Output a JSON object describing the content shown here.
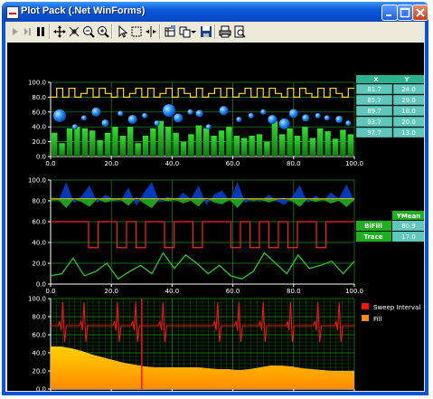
{
  "window": {
    "title": "Plot Pack (.Net WinForms)"
  },
  "toolbar": {
    "icons": [
      "play-icon",
      "step-icon",
      "pause-icon",
      "pan-icon",
      "axes-pan-icon",
      "zoom-out-icon",
      "zoom-in-icon",
      "select-pointer-icon",
      "zoom-box-icon",
      "cursor-icon",
      "data-view-icon",
      "copy-icon",
      "dropdown-icon",
      "save-icon",
      "print-icon",
      "print-preview-icon"
    ]
  },
  "axes": {
    "x_ticks": [
      "0.0",
      "20.0",
      "40.0",
      "60.0",
      "80.0",
      "100.0"
    ],
    "y_ticks": [
      "100.0",
      "80.0",
      "60.0",
      "40.0",
      "20.0",
      "0.0"
    ]
  },
  "table1": {
    "headers": [
      "X",
      "Y"
    ],
    "rows": [
      [
        "81.7",
        "24.0"
      ],
      [
        "85.7",
        "29.0"
      ],
      [
        "89.7",
        "18.0"
      ],
      [
        "93.7",
        "20.0"
      ],
      [
        "97.7",
        "13.0"
      ]
    ]
  },
  "table2": {
    "header": "YMean",
    "rows": [
      [
        "BiFill",
        "80.9"
      ],
      [
        "Trace",
        "17.0"
      ]
    ]
  },
  "legend3": {
    "items": [
      {
        "label": "Sweep Interval",
        "color": "#ff1010"
      },
      {
        "label": "Fill",
        "color": "#ff8c00"
      }
    ]
  },
  "chart_data": [
    {
      "type": "line",
      "panel": "top",
      "ylim": [
        0,
        100
      ],
      "xlim": [
        0,
        100
      ],
      "series": [
        {
          "kind": "step",
          "color": "#ffe000",
          "values": [
            80,
            92,
            80,
            92,
            80,
            85,
            92,
            80,
            92,
            85,
            80,
            92,
            80,
            85,
            92,
            80,
            92,
            80,
            85,
            92,
            80,
            92,
            85,
            80,
            92,
            80,
            85,
            92,
            80,
            92,
            80,
            85,
            92,
            80,
            92,
            80,
            92,
            85,
            80,
            92,
            80,
            92,
            85,
            80,
            92,
            80,
            92,
            85,
            80,
            92
          ]
        },
        {
          "kind": "bubble",
          "color": "#1e90ff",
          "points": [
            [
              3,
              55,
              7
            ],
            [
              8,
              40,
              3
            ],
            [
              11,
              52,
              3
            ],
            [
              15,
              60,
              5
            ],
            [
              18,
              45,
              4
            ],
            [
              23,
              58,
              3
            ],
            [
              27,
              50,
              5
            ],
            [
              31,
              55,
              3
            ],
            [
              35,
              45,
              3
            ],
            [
              39,
              62,
              7
            ],
            [
              42,
              52,
              5
            ],
            [
              46,
              60,
              3
            ],
            [
              49,
              58,
              4
            ],
            [
              52,
              40,
              3
            ],
            [
              57,
              62,
              5
            ],
            [
              62,
              50,
              3
            ],
            [
              66,
              55,
              3
            ],
            [
              70,
              60,
              3
            ],
            [
              73,
              50,
              5
            ],
            [
              77,
              44,
              6
            ],
            [
              80,
              58,
              5
            ],
            [
              84,
              52,
              4
            ],
            [
              88,
              55,
              3
            ],
            [
              91,
              52,
              3
            ],
            [
              95,
              50,
              4
            ],
            [
              98,
              45,
              3
            ]
          ]
        },
        {
          "kind": "bar",
          "color": "#22cc22",
          "values": [
            32,
            18,
            38,
            40,
            38,
            35,
            22,
            32,
            40,
            28,
            40,
            18,
            28,
            38,
            48,
            40,
            32,
            20,
            30,
            42,
            38,
            28,
            35,
            40,
            28,
            25,
            28,
            30,
            20,
            48,
            30,
            38,
            28,
            40,
            25,
            38,
            34,
            24,
            36,
            30
          ]
        }
      ]
    },
    {
      "type": "area",
      "panel": "middle",
      "ylim": [
        0,
        100
      ],
      "xlim": [
        0,
        100
      ],
      "series": [
        {
          "kind": "bifill",
          "color": "#0040d0",
          "values": [
            82,
            80,
            98,
            78,
            85,
            95,
            78,
            86,
            82,
            80,
            93,
            75,
            88,
            98,
            78,
            84,
            80,
            88,
            82,
            95,
            76,
            86,
            90,
            80,
            98,
            78,
            82,
            80,
            86,
            80,
            76,
            84,
            95,
            78,
            85,
            80,
            88,
            82,
            96,
            80
          ]
        },
        {
          "kind": "step",
          "color": "#ff2020",
          "values": [
            60,
            60,
            60,
            60,
            35,
            60,
            60,
            35,
            60,
            35,
            60,
            60,
            35,
            60,
            60,
            35,
            60,
            60,
            60,
            35,
            60,
            35,
            60,
            35,
            60,
            35,
            60,
            60,
            35,
            60,
            60,
            60
          ]
        },
        {
          "kind": "line",
          "color": "#22cc22",
          "values": [
            8,
            10,
            25,
            8,
            12,
            20,
            5,
            12,
            18,
            10,
            30,
            15,
            28,
            20,
            10,
            18,
            8,
            5,
            12,
            30,
            20,
            10,
            28,
            15,
            18,
            22,
            10,
            22
          ]
        }
      ]
    },
    {
      "type": "line",
      "panel": "bottom",
      "ylim": [
        0,
        100
      ],
      "xlim": [
        0,
        100
      ],
      "series": [
        {
          "name": "Sweep Interval",
          "kind": "ecg",
          "color": "#ff1010",
          "baseline": 70
        },
        {
          "name": "Fill",
          "kind": "area",
          "color": "#ff8c00",
          "values": [
            47,
            47,
            45,
            42,
            38,
            35,
            32,
            29,
            27,
            25,
            24,
            24,
            24,
            24,
            24,
            23,
            22,
            22,
            21,
            22,
            24,
            26,
            26,
            25,
            23,
            22,
            21,
            20,
            20,
            20
          ]
        }
      ]
    }
  ]
}
